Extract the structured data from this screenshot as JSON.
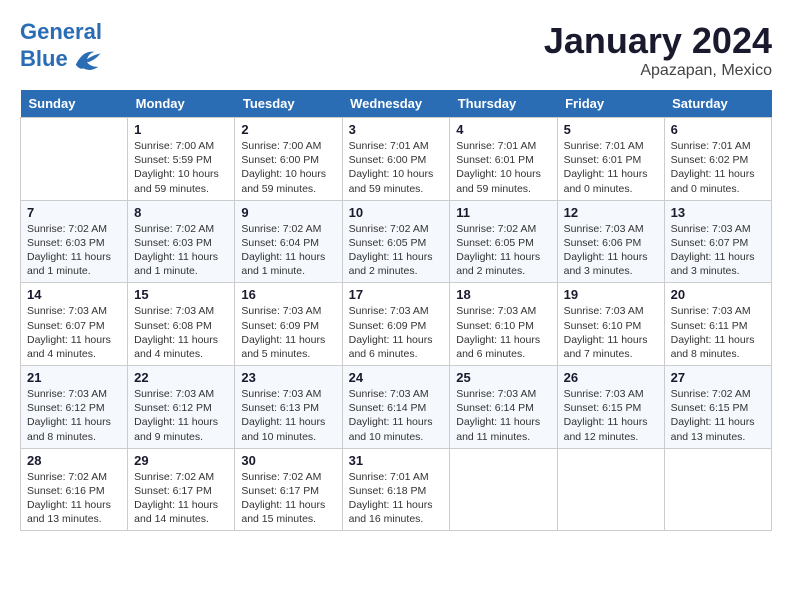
{
  "header": {
    "logo_line1": "General",
    "logo_line2": "Blue",
    "month": "January 2024",
    "location": "Apazapan, Mexico"
  },
  "days_of_week": [
    "Sunday",
    "Monday",
    "Tuesday",
    "Wednesday",
    "Thursday",
    "Friday",
    "Saturday"
  ],
  "weeks": [
    [
      {
        "day": "",
        "info": ""
      },
      {
        "day": "1",
        "info": "Sunrise: 7:00 AM\nSunset: 5:59 PM\nDaylight: 10 hours\nand 59 minutes."
      },
      {
        "day": "2",
        "info": "Sunrise: 7:00 AM\nSunset: 6:00 PM\nDaylight: 10 hours\nand 59 minutes."
      },
      {
        "day": "3",
        "info": "Sunrise: 7:01 AM\nSunset: 6:00 PM\nDaylight: 10 hours\nand 59 minutes."
      },
      {
        "day": "4",
        "info": "Sunrise: 7:01 AM\nSunset: 6:01 PM\nDaylight: 10 hours\nand 59 minutes."
      },
      {
        "day": "5",
        "info": "Sunrise: 7:01 AM\nSunset: 6:01 PM\nDaylight: 11 hours\nand 0 minutes."
      },
      {
        "day": "6",
        "info": "Sunrise: 7:01 AM\nSunset: 6:02 PM\nDaylight: 11 hours\nand 0 minutes."
      }
    ],
    [
      {
        "day": "7",
        "info": "Sunrise: 7:02 AM\nSunset: 6:03 PM\nDaylight: 11 hours\nand 1 minute."
      },
      {
        "day": "8",
        "info": "Sunrise: 7:02 AM\nSunset: 6:03 PM\nDaylight: 11 hours\nand 1 minute."
      },
      {
        "day": "9",
        "info": "Sunrise: 7:02 AM\nSunset: 6:04 PM\nDaylight: 11 hours\nand 1 minute."
      },
      {
        "day": "10",
        "info": "Sunrise: 7:02 AM\nSunset: 6:05 PM\nDaylight: 11 hours\nand 2 minutes."
      },
      {
        "day": "11",
        "info": "Sunrise: 7:02 AM\nSunset: 6:05 PM\nDaylight: 11 hours\nand 2 minutes."
      },
      {
        "day": "12",
        "info": "Sunrise: 7:03 AM\nSunset: 6:06 PM\nDaylight: 11 hours\nand 3 minutes."
      },
      {
        "day": "13",
        "info": "Sunrise: 7:03 AM\nSunset: 6:07 PM\nDaylight: 11 hours\nand 3 minutes."
      }
    ],
    [
      {
        "day": "14",
        "info": "Sunrise: 7:03 AM\nSunset: 6:07 PM\nDaylight: 11 hours\nand 4 minutes."
      },
      {
        "day": "15",
        "info": "Sunrise: 7:03 AM\nSunset: 6:08 PM\nDaylight: 11 hours\nand 4 minutes."
      },
      {
        "day": "16",
        "info": "Sunrise: 7:03 AM\nSunset: 6:09 PM\nDaylight: 11 hours\nand 5 minutes."
      },
      {
        "day": "17",
        "info": "Sunrise: 7:03 AM\nSunset: 6:09 PM\nDaylight: 11 hours\nand 6 minutes."
      },
      {
        "day": "18",
        "info": "Sunrise: 7:03 AM\nSunset: 6:10 PM\nDaylight: 11 hours\nand 6 minutes."
      },
      {
        "day": "19",
        "info": "Sunrise: 7:03 AM\nSunset: 6:10 PM\nDaylight: 11 hours\nand 7 minutes."
      },
      {
        "day": "20",
        "info": "Sunrise: 7:03 AM\nSunset: 6:11 PM\nDaylight: 11 hours\nand 8 minutes."
      }
    ],
    [
      {
        "day": "21",
        "info": "Sunrise: 7:03 AM\nSunset: 6:12 PM\nDaylight: 11 hours\nand 8 minutes."
      },
      {
        "day": "22",
        "info": "Sunrise: 7:03 AM\nSunset: 6:12 PM\nDaylight: 11 hours\nand 9 minutes."
      },
      {
        "day": "23",
        "info": "Sunrise: 7:03 AM\nSunset: 6:13 PM\nDaylight: 11 hours\nand 10 minutes."
      },
      {
        "day": "24",
        "info": "Sunrise: 7:03 AM\nSunset: 6:14 PM\nDaylight: 11 hours\nand 10 minutes."
      },
      {
        "day": "25",
        "info": "Sunrise: 7:03 AM\nSunset: 6:14 PM\nDaylight: 11 hours\nand 11 minutes."
      },
      {
        "day": "26",
        "info": "Sunrise: 7:03 AM\nSunset: 6:15 PM\nDaylight: 11 hours\nand 12 minutes."
      },
      {
        "day": "27",
        "info": "Sunrise: 7:02 AM\nSunset: 6:15 PM\nDaylight: 11 hours\nand 13 minutes."
      }
    ],
    [
      {
        "day": "28",
        "info": "Sunrise: 7:02 AM\nSunset: 6:16 PM\nDaylight: 11 hours\nand 13 minutes."
      },
      {
        "day": "29",
        "info": "Sunrise: 7:02 AM\nSunset: 6:17 PM\nDaylight: 11 hours\nand 14 minutes."
      },
      {
        "day": "30",
        "info": "Sunrise: 7:02 AM\nSunset: 6:17 PM\nDaylight: 11 hours\nand 15 minutes."
      },
      {
        "day": "31",
        "info": "Sunrise: 7:01 AM\nSunset: 6:18 PM\nDaylight: 11 hours\nand 16 minutes."
      },
      {
        "day": "",
        "info": ""
      },
      {
        "day": "",
        "info": ""
      },
      {
        "day": "",
        "info": ""
      }
    ]
  ]
}
